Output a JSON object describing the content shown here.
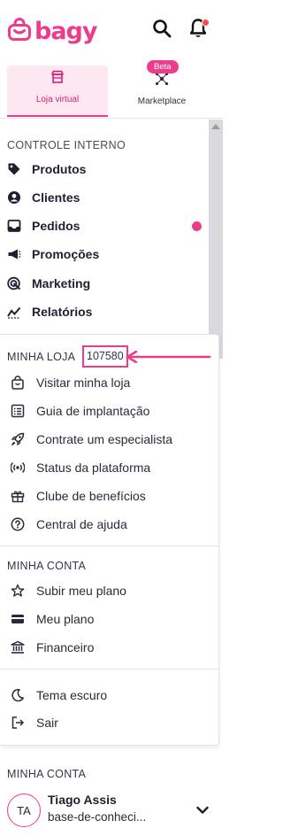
{
  "header": {
    "logo_text": "bagy",
    "search_icon": "search-icon",
    "bell_icon": "bell-icon"
  },
  "tabs": {
    "loja_virtual": "Loja virtual",
    "marketplace": "Marketplace",
    "beta": "Beta"
  },
  "controle": {
    "title": "CONTROLE INTERNO",
    "items": [
      {
        "label": "Produtos",
        "icon": "tag-icon"
      },
      {
        "label": "Clientes",
        "icon": "user-circle-icon"
      },
      {
        "label": "Pedidos",
        "icon": "inbox-icon"
      },
      {
        "label": "Promoções",
        "icon": "megaphone-icon"
      },
      {
        "label": "Marketing",
        "icon": "target-icon"
      },
      {
        "label": "Relatórios",
        "icon": "chart-line-icon"
      }
    ]
  },
  "minha_loja": {
    "title": "MINHA LOJA",
    "store_id": "107580",
    "items": [
      {
        "label": "Visitar minha loja",
        "icon": "shopping-bag-icon"
      },
      {
        "label": "Guia de implantação",
        "icon": "list-icon"
      },
      {
        "label": "Contrate um especialista",
        "icon": "rocket-icon"
      },
      {
        "label": "Status da plataforma",
        "icon": "broadcast-icon"
      },
      {
        "label": "Clube de benefícios",
        "icon": "gift-icon"
      },
      {
        "label": "Central de ajuda",
        "icon": "help-circle-icon"
      }
    ]
  },
  "minha_conta": {
    "title": "MINHA CONTA",
    "items": [
      {
        "label": "Subir meu plano",
        "icon": "star-icon"
      },
      {
        "label": "Meu plano",
        "icon": "credit-card-icon"
      },
      {
        "label": "Financeiro",
        "icon": "bank-icon"
      }
    ]
  },
  "other": {
    "items": [
      {
        "label": "Tema escuro",
        "icon": "moon-icon"
      },
      {
        "label": "Sair",
        "icon": "logout-icon"
      }
    ]
  },
  "footer": {
    "title": "MINHA CONTA",
    "avatar": "TA",
    "name": "Tiago Assis",
    "subtitle": "base-de-conheci..."
  },
  "colors": {
    "brand": "#ec3c8c",
    "notification": "#ff4d4d"
  }
}
